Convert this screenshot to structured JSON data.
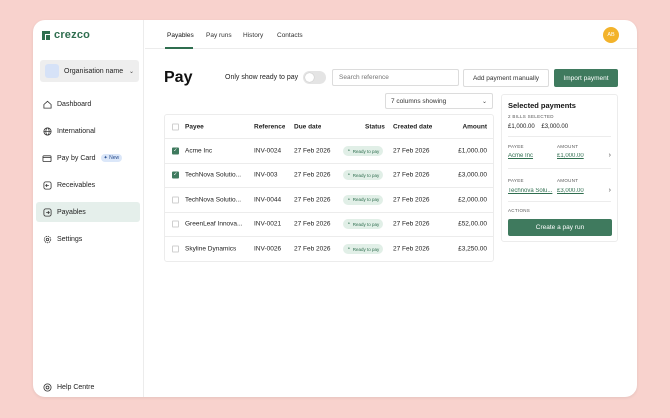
{
  "app": {
    "logo_text": "crezco"
  },
  "sidebar": {
    "org_name": "Organisation name",
    "items": [
      {
        "label": "Dashboard",
        "icon": "home-icon"
      },
      {
        "label": "International",
        "icon": "globe-icon"
      },
      {
        "label": "Pay by Card",
        "icon": "card-icon",
        "badge": "New"
      },
      {
        "label": "Receivables",
        "icon": "receivables-icon"
      },
      {
        "label": "Payables",
        "icon": "payables-icon",
        "active": true
      },
      {
        "label": "Settings",
        "icon": "gear-icon"
      }
    ],
    "help_label": "Help Centre"
  },
  "topnav": {
    "tabs": [
      {
        "label": "Payables",
        "active": true
      },
      {
        "label": "Pay runs"
      },
      {
        "label": "History"
      },
      {
        "label": "Contacts"
      }
    ],
    "avatar_initials": "AB"
  },
  "page": {
    "title": "Pay",
    "toggle_label": "Only show ready to pay",
    "toggle_on": false,
    "search_placeholder": "Search reference",
    "add_payment_label": "Add payment manually",
    "import_payment_label": "Import payment",
    "columns_select": "7 columns showing"
  },
  "table": {
    "headers": {
      "payee": "Payee",
      "reference": "Reference",
      "due_date": "Due date",
      "status": "Status",
      "created_date": "Created date",
      "amount": "Amount"
    },
    "rows": [
      {
        "checked": true,
        "payee": "Acme Inc",
        "reference": "INV-0024",
        "due_date": "27 Feb 2026",
        "status": "Ready to pay",
        "created_date": "27 Feb 2026",
        "amount": "£1,000.00"
      },
      {
        "checked": true,
        "payee": "TechNova Solutio...",
        "reference": "INV-003",
        "due_date": "27 Feb 2026",
        "status": "Ready to pay",
        "created_date": "27 Feb 2026",
        "amount": "£3,000.00"
      },
      {
        "checked": false,
        "payee": "TechNova Solutio...",
        "reference": "INV-0044",
        "due_date": "27 Feb 2026",
        "status": "Ready to pay",
        "created_date": "27 Feb 2026",
        "amount": "£2,000.00"
      },
      {
        "checked": false,
        "payee": "GreenLeaf Innova...",
        "reference": "INV-0021",
        "due_date": "27 Feb 2026",
        "status": "Ready to pay",
        "created_date": "27 Feb 2026",
        "amount": "£52,00.00"
      },
      {
        "checked": false,
        "payee": "Skyline Dynamics",
        "reference": "INV-0026",
        "due_date": "27 Feb 2026",
        "status": "Ready to pay",
        "created_date": "27 Feb 2026",
        "amount": "£3,250.00"
      }
    ]
  },
  "panel": {
    "title": "Selected payments",
    "bills_selected": "2 BILLS SELECTED",
    "totals": [
      "£1,000.00",
      "£3,000.00"
    ],
    "payee_label": "PAYEE",
    "amount_label": "AMOUNT",
    "items": [
      {
        "payee": "Acme Inc",
        "amount": "£1,000.00"
      },
      {
        "payee": "Technova Solu...",
        "amount": "£3,000.00"
      }
    ],
    "actions_label": "ACTIONS",
    "create_label": "Create a pay run"
  },
  "colors": {
    "brand": "#3f7a5e",
    "background": "#f8d2cd",
    "avatar": "#f3b32b"
  }
}
